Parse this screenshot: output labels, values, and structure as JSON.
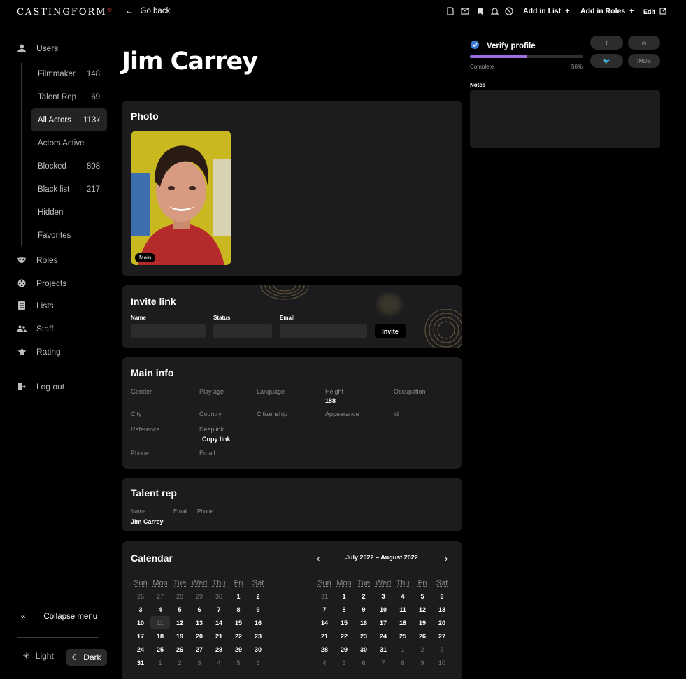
{
  "brand": {
    "logo_text": "CASTINGFORM",
    "logo_dot": "®"
  },
  "sidebar": {
    "users_label": "Users",
    "subitems": [
      {
        "label": "Filmmaker",
        "count": "148"
      },
      {
        "label": "Talent Rep",
        "count": "69"
      },
      {
        "label": "All Actors",
        "count": "113k",
        "active": true
      },
      {
        "label": "Actors Active",
        "count": ""
      },
      {
        "label": "Blocked",
        "count": "808"
      },
      {
        "label": "Black list",
        "count": "217"
      },
      {
        "label": "Hidden",
        "count": ""
      },
      {
        "label": "Favorites",
        "count": ""
      }
    ],
    "items": [
      {
        "label": "Roles",
        "icon": "mask-icon"
      },
      {
        "label": "Projects",
        "icon": "film-reel-icon"
      },
      {
        "label": "Lists",
        "icon": "list-icon"
      },
      {
        "label": "Staff",
        "icon": "staff-icon"
      },
      {
        "label": "Rating",
        "icon": "star-icon"
      }
    ],
    "logout_label": "Log out",
    "collapse_label": "Collapse menu",
    "theme_light": "Light",
    "theme_dark": "Dark"
  },
  "topbar": {
    "go_back": "Go back",
    "add_in_list": "Add in List",
    "add_in_roles": "Add in Roles",
    "edit": "Edit"
  },
  "profile": {
    "name": "Jim Carrey",
    "verify_label": "Verify profile",
    "complete_label": "Complete",
    "complete_percent": "50%",
    "complete_value": 0.5,
    "social": [
      "f",
      "◎",
      "🐦",
      "IMDB"
    ],
    "notes_label": "Notes"
  },
  "photo_card": {
    "title": "Photo",
    "tag": "Main"
  },
  "invite_card": {
    "title": "Invite link",
    "name_label": "Name",
    "status_label": "Status",
    "email_label": "Email",
    "invite_button": "Invite"
  },
  "main_info": {
    "title": "Main info",
    "gender": "Gender",
    "play_age": "Play age",
    "language": "Language",
    "height": "Height",
    "height_value": "188",
    "occupation": "Occupation",
    "city": "City",
    "country": "Country",
    "citizenship": "Citizenship",
    "appearance": "Appearance",
    "id": "id",
    "reference": "Reference",
    "deeplink": "Deeplink",
    "copy_link": "Copy link",
    "phone": "Phone",
    "email": "Email"
  },
  "talent_rep": {
    "title": "Talent rep",
    "name_label": "Name",
    "email_label": "Email",
    "phone_label": "Phone",
    "name_value": "Jim Carrey"
  },
  "calendar": {
    "title": "Calendar",
    "range": "July 2022 – August 2022",
    "weekdays": [
      "Sun",
      "Mon",
      "Tue",
      "Wed",
      "Thu",
      "Fri",
      "Sat"
    ],
    "months": [
      {
        "weeks": [
          [
            [
              "26",
              1
            ],
            [
              "27",
              1
            ],
            [
              "28",
              1
            ],
            [
              "29",
              1
            ],
            [
              "30",
              1
            ],
            [
              "1",
              0
            ],
            [
              "2",
              0
            ]
          ],
          [
            [
              "3",
              0
            ],
            [
              "4",
              0
            ],
            [
              "5",
              0
            ],
            [
              "6",
              0
            ],
            [
              "7",
              0
            ],
            [
              "8",
              0
            ],
            [
              "9",
              0
            ]
          ],
          [
            [
              "10",
              0
            ],
            [
              "11",
              2
            ],
            [
              "12",
              0
            ],
            [
              "13",
              0
            ],
            [
              "14",
              0
            ],
            [
              "15",
              0
            ],
            [
              "16",
              0
            ]
          ],
          [
            [
              "17",
              0
            ],
            [
              "18",
              0
            ],
            [
              "19",
              0
            ],
            [
              "20",
              0
            ],
            [
              "21",
              0
            ],
            [
              "22",
              0
            ],
            [
              "23",
              0
            ]
          ],
          [
            [
              "24",
              0
            ],
            [
              "25",
              0
            ],
            [
              "26",
              0
            ],
            [
              "27",
              0
            ],
            [
              "28",
              0
            ],
            [
              "29",
              0
            ],
            [
              "30",
              0
            ]
          ],
          [
            [
              "31",
              0
            ],
            [
              "1",
              1
            ],
            [
              "2",
              1
            ],
            [
              "3",
              1
            ],
            [
              "4",
              1
            ],
            [
              "5",
              1
            ],
            [
              "6",
              1
            ]
          ]
        ]
      },
      {
        "weeks": [
          [
            [
              "31",
              1
            ],
            [
              "1",
              0
            ],
            [
              "2",
              0
            ],
            [
              "3",
              0
            ],
            [
              "4",
              0
            ],
            [
              "5",
              0
            ],
            [
              "6",
              0
            ]
          ],
          [
            [
              "7",
              0
            ],
            [
              "8",
              0
            ],
            [
              "9",
              0
            ],
            [
              "10",
              0
            ],
            [
              "11",
              0
            ],
            [
              "12",
              0
            ],
            [
              "13",
              0
            ]
          ],
          [
            [
              "14",
              0
            ],
            [
              "15",
              0
            ],
            [
              "16",
              0
            ],
            [
              "17",
              0
            ],
            [
              "18",
              0
            ],
            [
              "19",
              0
            ],
            [
              "20",
              0
            ]
          ],
          [
            [
              "21",
              0
            ],
            [
              "22",
              0
            ],
            [
              "23",
              0
            ],
            [
              "24",
              0
            ],
            [
              "25",
              0
            ],
            [
              "26",
              0
            ],
            [
              "27",
              0
            ]
          ],
          [
            [
              "28",
              0
            ],
            [
              "29",
              0
            ],
            [
              "30",
              0
            ],
            [
              "31",
              0
            ],
            [
              "1",
              1
            ],
            [
              "2",
              1
            ],
            [
              "3",
              1
            ]
          ],
          [
            [
              "4",
              1
            ],
            [
              "5",
              1
            ],
            [
              "6",
              1
            ],
            [
              "7",
              1
            ],
            [
              "8",
              1
            ],
            [
              "9",
              1
            ],
            [
              "10",
              1
            ]
          ]
        ]
      }
    ]
  }
}
